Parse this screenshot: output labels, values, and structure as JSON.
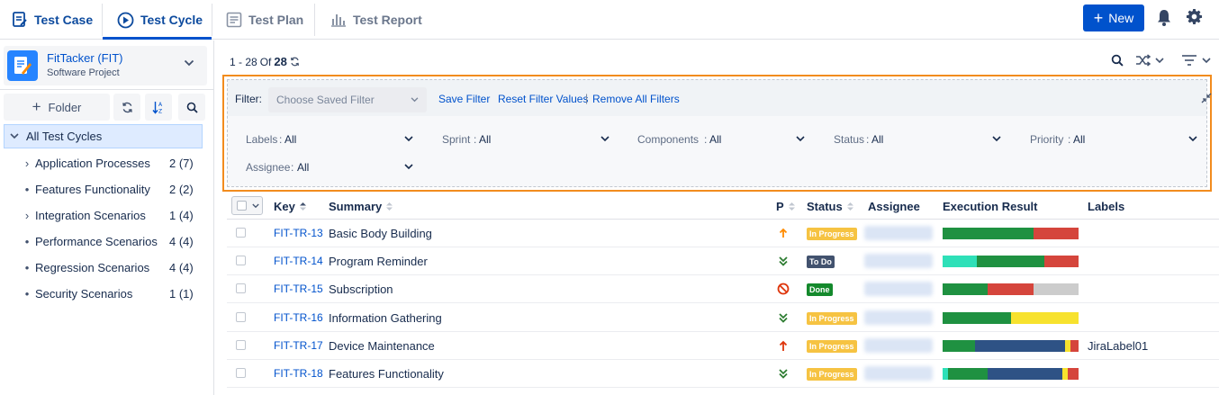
{
  "nav": {
    "tabs": [
      {
        "label": "Test Case",
        "icon": "test-case-icon"
      },
      {
        "label": "Test Cycle",
        "icon": "test-cycle-icon"
      },
      {
        "label": "Test Plan",
        "icon": "test-plan-icon"
      },
      {
        "label": "Test Report",
        "icon": "test-report-icon"
      }
    ],
    "new_button": "New",
    "icons": [
      "bell-icon",
      "gear-icon"
    ]
  },
  "project": {
    "name": "FitTacker (FIT)",
    "type": "Software Project"
  },
  "sidebar": {
    "folder_button": "Folder",
    "root": "All Test Cycles",
    "items": [
      {
        "label": "Application Processes",
        "count": "2 (7)",
        "expandable": true
      },
      {
        "label": "Features Functionality",
        "count": "2 (2)",
        "expandable": false
      },
      {
        "label": "Integration Scenarios",
        "count": "1 (4)",
        "expandable": true
      },
      {
        "label": "Performance Scenarios",
        "count": "4 (4)",
        "expandable": false
      },
      {
        "label": "Regression Scenarios",
        "count": "4 (4)",
        "expandable": false
      },
      {
        "label": "Security Scenarios",
        "count": "1 (1)",
        "expandable": false
      }
    ]
  },
  "pagination": {
    "range": "1 - 28",
    "of": "Of",
    "total": "28"
  },
  "filter": {
    "label": "Filter:",
    "saved_placeholder": "Choose Saved Filter",
    "save_link": "Save Filter",
    "reset_link": "Reset Filter Values",
    "separator": "|",
    "remove_link": "Remove All Filters",
    "fields": [
      {
        "label": "Labels",
        "value": "All"
      },
      {
        "label": "Sprint",
        "value": "All"
      },
      {
        "label": "Components",
        "value": "All"
      },
      {
        "label": "Status",
        "value": "All"
      },
      {
        "label": "Priority",
        "value": "All"
      },
      {
        "label": "Assignee",
        "value": "All"
      }
    ]
  },
  "table": {
    "headers": {
      "key": "Key",
      "summary": "Summary",
      "priority": "P",
      "status": "Status",
      "assignee": "Assignee",
      "execution": "Execution Result",
      "labels": "Labels"
    },
    "rows": [
      {
        "key": "FIT-TR-13",
        "summary": "Basic Body Building",
        "priority": "medium-arrow-up",
        "status": "In Progress",
        "label": "",
        "execution": [
          {
            "color": "#1f9141",
            "frac": 0.67
          },
          {
            "color": "#d5453c",
            "frac": 0.33
          }
        ]
      },
      {
        "key": "FIT-TR-14",
        "summary": "Program Reminder",
        "priority": "lowest-double-chevron",
        "status": "To Do",
        "label": "",
        "execution": [
          {
            "color": "#2ee0b8",
            "frac": 0.25
          },
          {
            "color": "#1f9141",
            "frac": 0.5
          },
          {
            "color": "#d5453c",
            "frac": 0.25
          }
        ]
      },
      {
        "key": "FIT-TR-15",
        "summary": "Subscription",
        "priority": "blocker-icon",
        "status": "Done",
        "label": "",
        "execution": [
          {
            "color": "#1f9141",
            "frac": 0.33
          },
          {
            "color": "#d5453c",
            "frac": 0.34
          },
          {
            "color": "#cccccc",
            "frac": 0.33
          }
        ]
      },
      {
        "key": "FIT-TR-16",
        "summary": "Information Gathering",
        "priority": "lowest-double-chevron",
        "status": "In Progress",
        "label": "",
        "execution": [
          {
            "color": "#1f9141",
            "frac": 0.5
          },
          {
            "color": "#f7e22e",
            "frac": 0.5
          }
        ]
      },
      {
        "key": "FIT-TR-17",
        "summary": "Device Maintenance",
        "priority": "highest-arrow-up",
        "status": "In Progress",
        "label": "JiraLabel01",
        "execution": [
          {
            "color": "#1f9141",
            "frac": 0.24
          },
          {
            "color": "#2e5285",
            "frac": 0.66
          },
          {
            "color": "#f7e22e",
            "frac": 0.04
          },
          {
            "color": "#d5453c",
            "frac": 0.06
          }
        ]
      },
      {
        "key": "FIT-TR-18",
        "summary": "Features Functionality",
        "priority": "lowest-double-chevron",
        "status": "In Progress",
        "label": "",
        "execution": [
          {
            "color": "#2ee0b8",
            "frac": 0.04
          },
          {
            "color": "#1f9141",
            "frac": 0.29
          },
          {
            "color": "#2e5285",
            "frac": 0.55
          },
          {
            "color": "#f7e22e",
            "frac": 0.04
          },
          {
            "color": "#d5453c",
            "frac": 0.08
          }
        ]
      }
    ]
  },
  "colors": {
    "accent": "#0052cc",
    "filter_border": "#f28c1e",
    "status_in_progress": "#f6c342",
    "status_todo": "#42526e",
    "status_done": "#14892c"
  }
}
